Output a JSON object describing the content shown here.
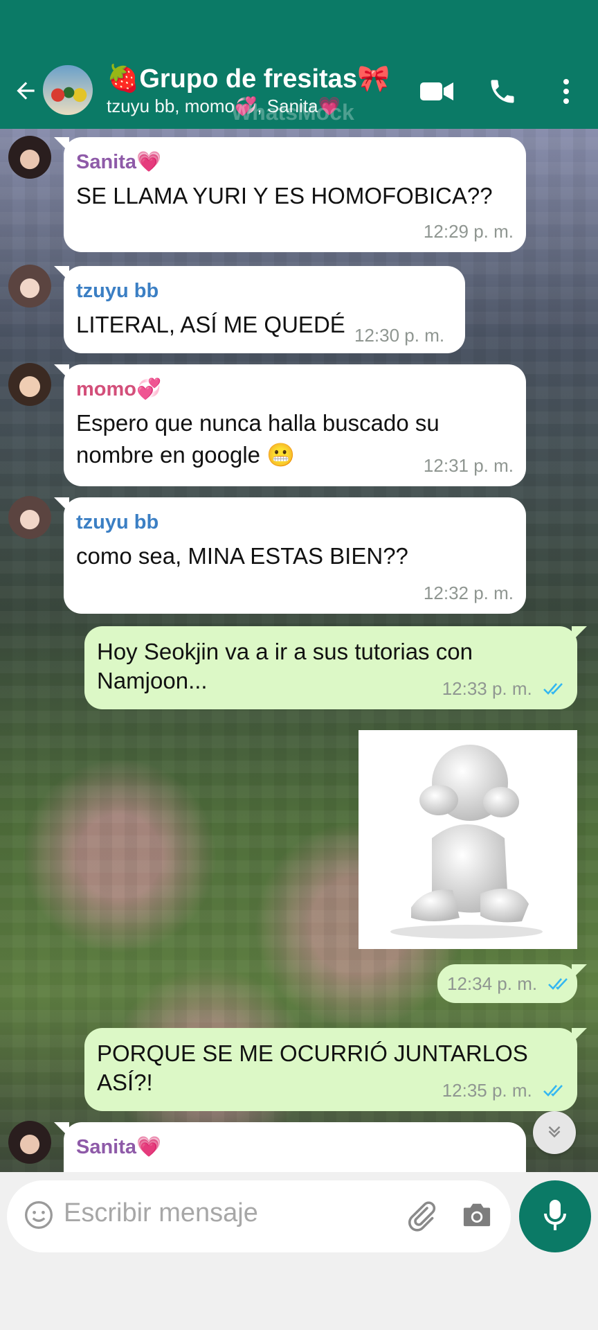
{
  "header": {
    "title": "🍓Grupo de fresitas🎀",
    "subtitle": "tzuyu bb, momo💞, Sanita💗",
    "watermark": "WhatsMock"
  },
  "colors": {
    "header": "#0b7a66",
    "incoming": "#ffffff",
    "outgoing": "#dcf8c6",
    "read_ticks": "#34b7f1"
  },
  "messages": [
    {
      "sender": "Sanita💗",
      "text": "SE LLAMA YURI Y ES HOMOFOBICA??",
      "time": "12:29 p. m."
    },
    {
      "sender": "tzuyu bb",
      "text": "LITERAL, ASÍ ME QUEDÉ",
      "time": "12:30 p. m."
    },
    {
      "sender": "momo💞",
      "text_line1": "Espero que nunca halla buscado su",
      "text_line2": "nombre en google 😬",
      "time": "12:31 p. m."
    },
    {
      "sender": "tzuyu bb",
      "text": "como sea, MINA ESTAS BIEN??",
      "time": "12:32 p. m."
    },
    {
      "text_line1": "Hoy Seokjin va a ir a sus tutorias con",
      "text_line2": "Namjoon...",
      "time": "12:33 p. m."
    },
    {
      "time": "12:34 p. m."
    },
    {
      "text_line1": "PORQUE SE ME OCURRIÓ JUNTARLOS",
      "text_line2": "ASÍ?!",
      "time": "12:35 p. m."
    },
    {
      "sender": "Sanita💗"
    }
  ],
  "composer": {
    "placeholder": "Escribir mensaje"
  },
  "icons": [
    "back-arrow-icon",
    "video-call-icon",
    "phone-icon",
    "more-options-icon",
    "double-check-icon",
    "chevron-down-icon",
    "emoji-icon",
    "paperclip-icon",
    "camera-icon",
    "microphone-icon"
  ]
}
